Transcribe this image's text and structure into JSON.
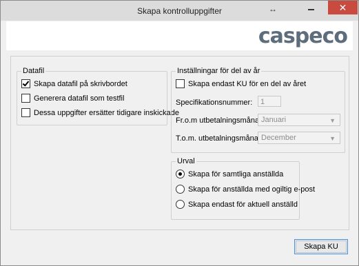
{
  "window": {
    "title": "Skapa kontrolluppgifter",
    "resize_icon": "↔",
    "close_glyph": "✕"
  },
  "header": {
    "logo_text": "caspeco"
  },
  "datafil": {
    "legend": "Datafil",
    "options": [
      {
        "label": "Skapa datafil på skrivbordet",
        "checked": true
      },
      {
        "label": "Generera datafil som testfil",
        "checked": false
      },
      {
        "label": "Dessa uppgifter ersätter tidigare inskickade",
        "checked": false
      }
    ]
  },
  "installningar": {
    "legend": "Inställningar för del av år",
    "only_part_label": "Skapa endast KU för en del av året",
    "spec_label": "Specifikationsnummer:",
    "spec_value": "1",
    "from_label": "Fr.o.m utbetalningsmånad:",
    "from_value": "Januari",
    "tom_label": "T.o.m. utbetalningsmånad:",
    "tom_value": "December"
  },
  "urval": {
    "legend": "Urval",
    "options": [
      {
        "label": "Skapa för samtliga anställda",
        "selected": true
      },
      {
        "label": "Skapa för anställda med ogiltig e-post",
        "selected": false
      },
      {
        "label": "Skapa endast för aktuell anställd",
        "selected": false
      }
    ]
  },
  "footer": {
    "submit_label": "Skapa KU"
  },
  "colors": {
    "close_button": "#c94a3f",
    "primary_border": "#4f91cf",
    "logo": "#5d6d7b"
  }
}
